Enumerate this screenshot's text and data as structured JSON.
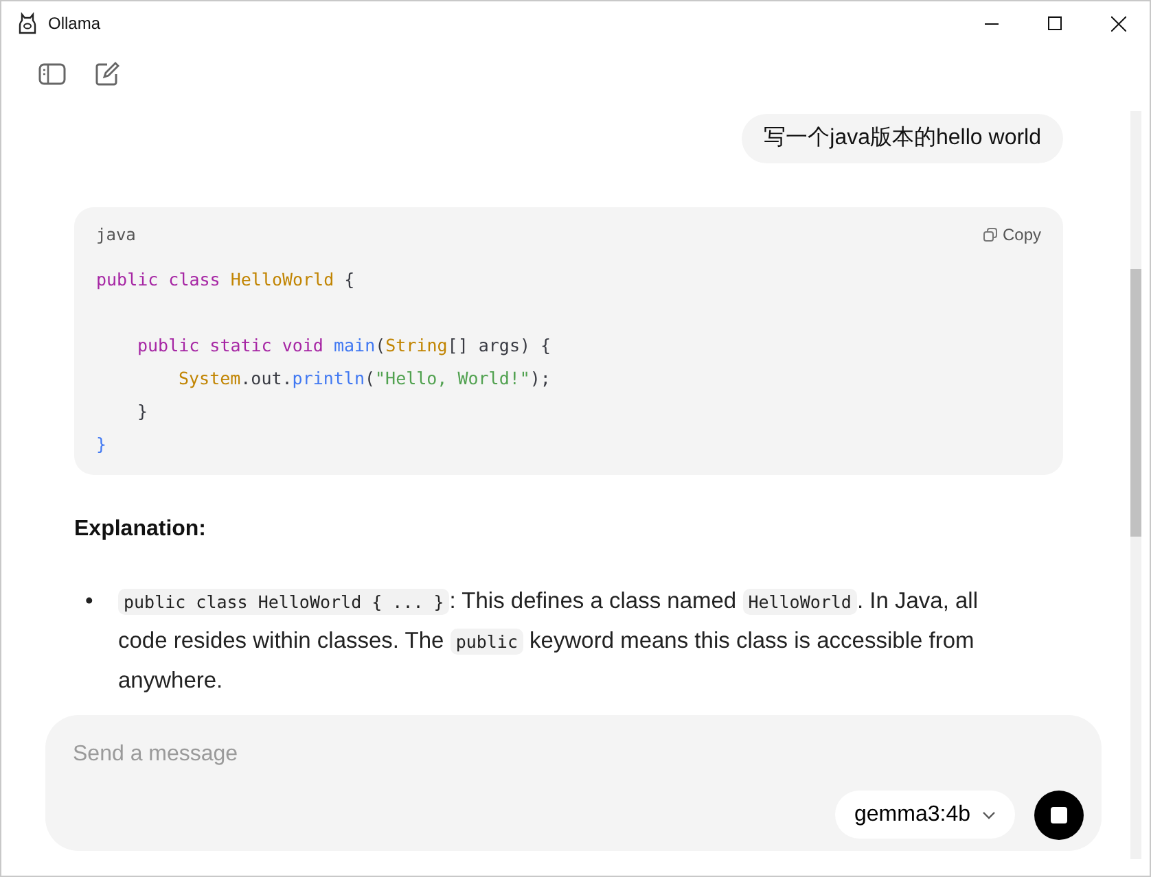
{
  "window": {
    "title": "Ollama"
  },
  "user_message": "写一个java版本的hello world",
  "code_block": {
    "language": "java",
    "copy_label": "Copy",
    "lines": [
      {
        "tokens": [
          {
            "kind": "keyword",
            "text": "public class "
          },
          {
            "kind": "type",
            "text": "HelloWorld"
          },
          {
            "kind": "plain",
            "text": " {"
          }
        ],
        "children": [
          {
            "gap_before": true,
            "tokens": [
              {
                "kind": "keyword",
                "text": "public static void "
              },
              {
                "kind": "function",
                "text": "main"
              },
              {
                "kind": "plain",
                "text": "("
              },
              {
                "kind": "type",
                "text": "String"
              },
              {
                "kind": "plain",
                "text": "[] args) {"
              }
            ],
            "children": [
              {
                "tokens": [
                  {
                    "kind": "type",
                    "text": "System"
                  },
                  {
                    "kind": "plain",
                    "text": ".out."
                  },
                  {
                    "kind": "function",
                    "text": "println"
                  },
                  {
                    "kind": "plain",
                    "text": "("
                  },
                  {
                    "kind": "string",
                    "text": "\"Hello, World!\""
                  },
                  {
                    "kind": "plain",
                    "text": ");"
                  }
                ]
              }
            ]
          },
          {
            "tokens": [
              {
                "kind": "plain",
                "text": "}"
              }
            ]
          }
        ]
      },
      {
        "tokens": [
          {
            "kind": "brace",
            "text": "}"
          }
        ]
      }
    ]
  },
  "heading": "Explanation:",
  "bullets": [
    {
      "marker": "•",
      "parts": [
        {
          "kind": "code",
          "text": "public class HelloWorld { ... }"
        },
        {
          "kind": "text",
          "text": ": This defines a class named "
        },
        {
          "kind": "code",
          "text": "HelloWorld"
        },
        {
          "kind": "text",
          "text": ". In Java, all code resides within classes. The "
        },
        {
          "kind": "code",
          "text": "public"
        },
        {
          "kind": "text",
          "text": " keyword means this class is accessible from anywhere."
        }
      ]
    }
  ],
  "composer": {
    "placeholder": "Send a message",
    "model": "gemma3:4b"
  }
}
